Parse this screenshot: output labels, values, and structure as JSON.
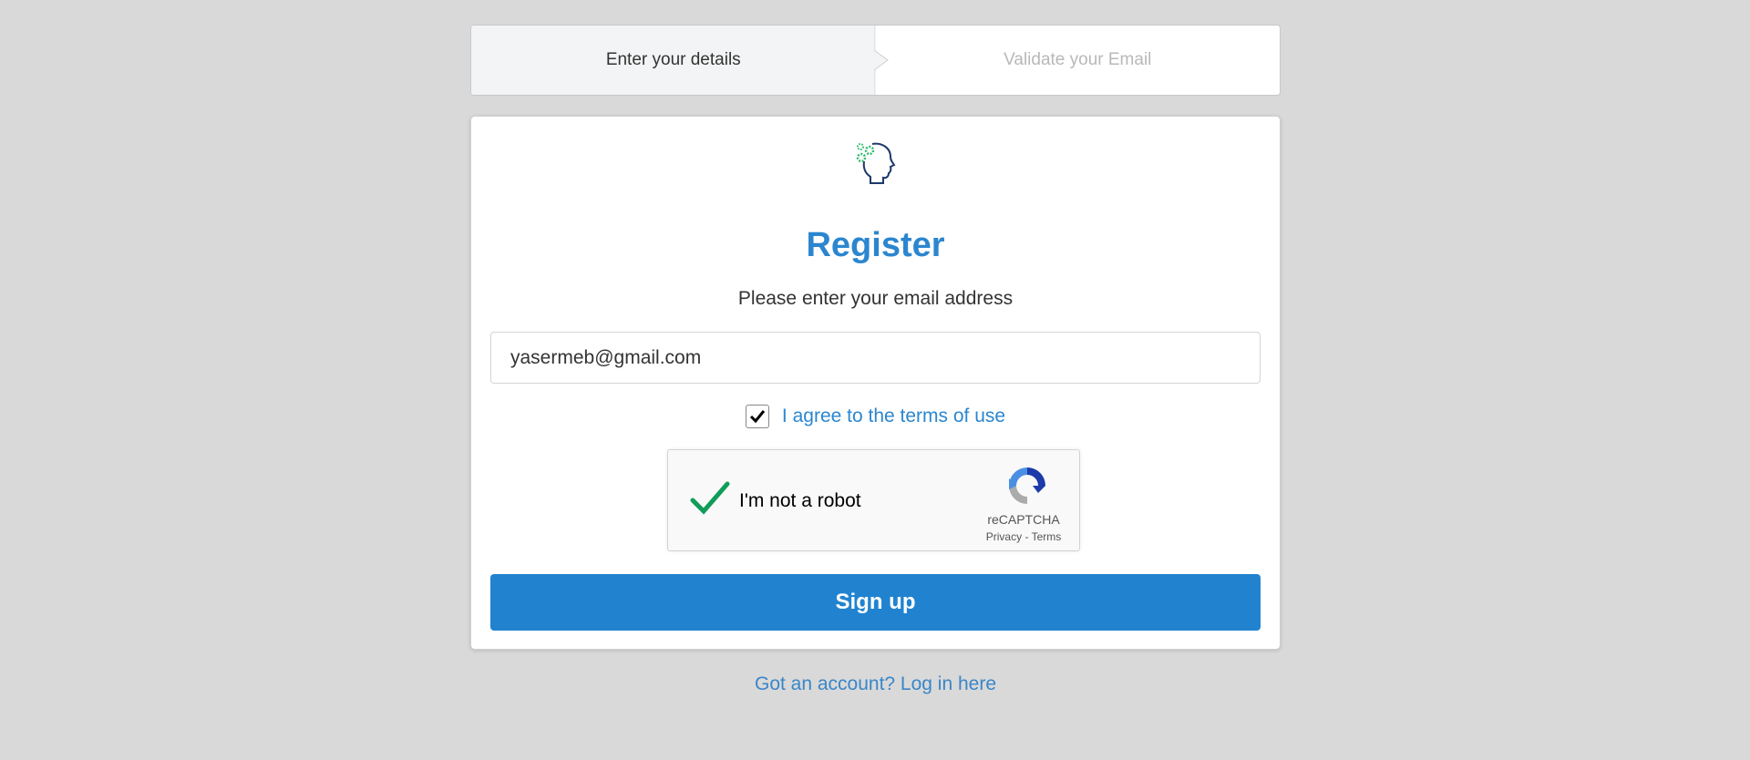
{
  "steps": [
    {
      "label": "Enter your details",
      "state": "active"
    },
    {
      "label": "Validate your Email",
      "state": "inactive"
    }
  ],
  "card": {
    "logo_icon": "head-with-gears-icon",
    "title": "Register",
    "subtitle": "Please enter your email address",
    "email_value": "yasermeb@gmail.com",
    "terms_checked": true,
    "terms_label": "I agree to the terms of use",
    "captcha": {
      "checked": true,
      "label": "I'm not a robot",
      "brand": "reCAPTCHA",
      "privacy": "Privacy",
      "separator": "-",
      "terms": "Terms"
    },
    "signup_label": "Sign up"
  },
  "login_link": "Got an account? Log in here",
  "colors": {
    "accent": "#2b86cf",
    "button": "#2183d0",
    "background": "#d9d9d9",
    "captcha_check": "#0f9d58"
  }
}
